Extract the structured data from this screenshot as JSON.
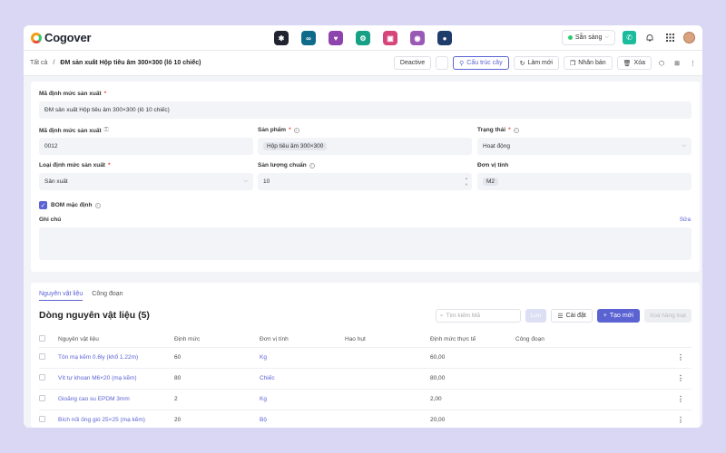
{
  "app": {
    "name": "Cogover"
  },
  "app_icons": [
    {
      "name": "apps-grid-icon",
      "color": "#1f2430",
      "glyph": "✱"
    },
    {
      "name": "link-app-icon",
      "color": "#0e6b8a",
      "glyph": "∞"
    },
    {
      "name": "heart-app-icon",
      "color": "#8e44ad",
      "glyph": "♥"
    },
    {
      "name": "settings-app-icon",
      "color": "#16a085",
      "glyph": "⚙"
    },
    {
      "name": "inbox-app-icon",
      "color": "#d6457a",
      "glyph": "▣"
    },
    {
      "name": "chat-app-icon",
      "color": "#9b59b6",
      "glyph": "◉"
    },
    {
      "name": "user-app-icon",
      "color": "#1e3d6b",
      "glyph": "●"
    }
  ],
  "topbar": {
    "status": "Sẵn sàng"
  },
  "breadcrumb": {
    "root": "Tất cả",
    "sep": "/",
    "current": "ĐM sản xuất Hộp tiêu âm 300×300 (lô 10 chiếc)"
  },
  "actions": {
    "deactive": "Deactive",
    "structure": "Cấu trúc cây",
    "refresh": "Làm mới",
    "duplicate": "Nhân bản",
    "delete": "Xóa"
  },
  "form": {
    "bom_name_label": "Mã định mức sản xuất",
    "bom_name_value": "ĐM sản xuất Hộp tiêu âm 300×300 (lô 10 chiếc)",
    "bom_code_label": "Mã định mức sản xuất",
    "bom_code_value": "0012",
    "product_label": "Sản phẩm",
    "product_value": "Hộp tiêu âm 300×300",
    "status_label": "Trạng thái",
    "status_value": "Hoạt động",
    "type_label": "Loại định mức sản xuất",
    "type_value": "Sản xuất",
    "qty_label": "Sản lượng chuẩn",
    "qty_value": "10",
    "unit_label": "Đơn vị tính",
    "unit_value": "M2",
    "default_bom_label": "BOM mặc định",
    "note_label": "Ghi chú",
    "edit_link": "Sửa"
  },
  "list": {
    "tabs": [
      "Nguyên vật liệu",
      "Công đoạn"
    ],
    "title": "Dòng nguyên vật liệu (5)",
    "search_placeholder": "Tìm kiếm Mã",
    "save": "Lưu",
    "settings": "Cài đặt",
    "add": "Tạo mới",
    "bulk_delete": "Xoá hàng loạt",
    "columns": [
      "Nguyên vật liệu",
      "Định mức",
      "Đơn vị tính",
      "Hao hụt",
      "Định mức thực tế",
      "Công đoạn"
    ],
    "rows": [
      {
        "material": "Tôn mạ kẽm 0.6ly (khổ 1.22m)",
        "norm": "60",
        "unit": "Kg",
        "loss": "",
        "actual": "60,00",
        "stage": ""
      },
      {
        "material": "Vít tự khoan M6×20 (mạ kẽm)",
        "norm": "80",
        "unit": "Chiếc",
        "loss": "",
        "actual": "80,00",
        "stage": ""
      },
      {
        "material": "Gioăng cao su EPDM 3mm",
        "norm": "2",
        "unit": "Kg",
        "loss": "",
        "actual": "2,00",
        "stage": ""
      },
      {
        "material": "Bích nối ống gió 25×25 (mạ kẽm)",
        "norm": "20",
        "unit": "Bộ",
        "loss": "",
        "actual": "20,00",
        "stage": ""
      }
    ]
  }
}
